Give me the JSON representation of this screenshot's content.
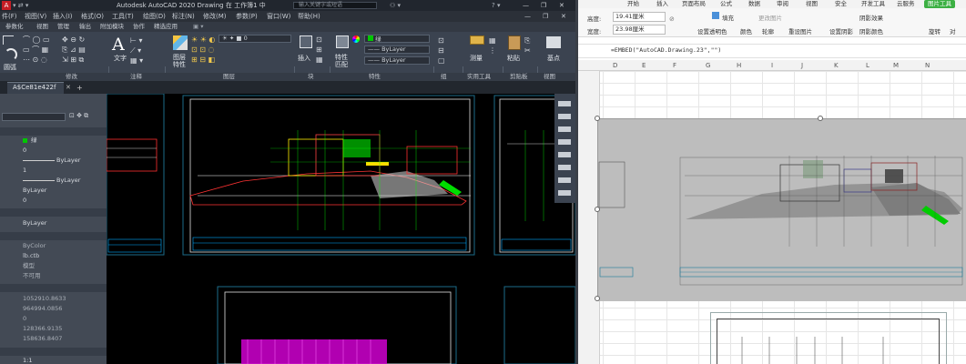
{
  "autocad": {
    "title": "Autodesk AutoCAD 2020   Drawing 在 工作簿1 中",
    "search_placeholder": "输入关键字或短语",
    "menu": [
      "件(F)",
      "视图(V)",
      "插入(I)",
      "格式(O)",
      "工具(T)",
      "绘图(D)",
      "标注(N)",
      "修改(M)",
      "参数(P)",
      "窗口(W)",
      "帮助(H)"
    ],
    "ribbon_tabs": [
      "参数化",
      "视图",
      "管理",
      "输出",
      "附加模块",
      "协作",
      "精选应用"
    ],
    "ribbon": {
      "draw_round": "圆弧",
      "text": "文字",
      "annotation_panel": "注释",
      "modify_panel": "修改",
      "layer_props": "图层\n特性",
      "layer_value": "0",
      "layers_panel": "图层",
      "insert": "插入",
      "block_panel": "块",
      "match_props": "特性\n匹配",
      "color_value": "绿",
      "linetype_value": "ByLayer",
      "lineweight_value": "ByLayer",
      "properties_panel": "特性",
      "group_panel": "组",
      "measure": "测量",
      "utilities_panel": "实用工具",
      "paste": "粘贴",
      "clipboard_panel": "剪贴板",
      "base": "基点",
      "view_panel": "视图"
    },
    "doc_tab": "A$Ce81e422f",
    "palette": {
      "color": "绿",
      "layer_value": "0",
      "linetype": "ByLayer",
      "linetype_scale": "1",
      "lineweight": "ByLayer",
      "layer": "ByLayer",
      "transparency": "0",
      "hyperlink": "ByLayer",
      "plot_style": "ByColor",
      "plot_style_table": "lb.ctb",
      "plot_attached": "模型",
      "plot_type": "不可用",
      "x": "1052910.8633",
      "y": "964994.0856",
      "z": "0",
      "height": "128366.9135",
      "width": "158636.8407",
      "scale": "1:1"
    }
  },
  "excel": {
    "tabs": [
      "开始",
      "插入",
      "页面布局",
      "公式",
      "数据",
      "审阅",
      "视图",
      "安全",
      "开发工具",
      "云服务"
    ],
    "pic_tool": "图片工具",
    "height_label": "高度:",
    "height_value": "19.41厘米",
    "width_label": "宽度:",
    "width_value": "23.98厘米",
    "tools": [
      "填充",
      "更改图片",
      "设置透明色",
      "颜色",
      "轮廓",
      "重设图片",
      "阴影效果",
      "阴影颜色",
      "设置阴影",
      "旋转",
      "对"
    ],
    "formula": "=EMBED(\"AutoCAD.Drawing.23\",\"\")",
    "columns": [
      "D",
      "E",
      "F",
      "G",
      "H",
      "I",
      "J",
      "K",
      "L",
      "M",
      "N"
    ]
  }
}
